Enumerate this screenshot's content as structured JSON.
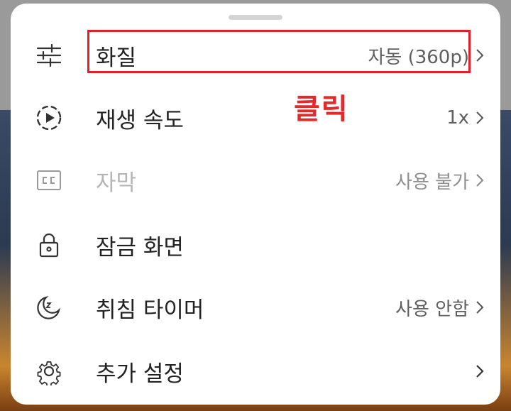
{
  "menu": {
    "items": [
      {
        "label": "화질",
        "value": "자동 (360p)",
        "icon": "sliders-icon",
        "has_chevron": true,
        "enabled": true
      },
      {
        "label": "재생 속도",
        "value": "1x",
        "icon": "playback-speed-icon",
        "has_chevron": true,
        "enabled": true
      },
      {
        "label": "자막",
        "value": "사용 불가",
        "icon": "captions-icon",
        "has_chevron": true,
        "enabled": false
      },
      {
        "label": "잠금 화면",
        "value": "",
        "icon": "lock-icon",
        "has_chevron": false,
        "enabled": true
      },
      {
        "label": "취침 타이머",
        "value": "사용 안함",
        "icon": "moon-sleep-icon",
        "has_chevron": true,
        "enabled": true
      },
      {
        "label": "추가 설정",
        "value": "",
        "icon": "gear-icon",
        "has_chevron": true,
        "enabled": true
      }
    ]
  },
  "annotation": {
    "text": "클릭",
    "color": "#e32a2a"
  },
  "colors": {
    "highlight_border": "#e0212b",
    "sheet": "#ffffff",
    "label": "#222222",
    "value": "#5f5f5f"
  }
}
